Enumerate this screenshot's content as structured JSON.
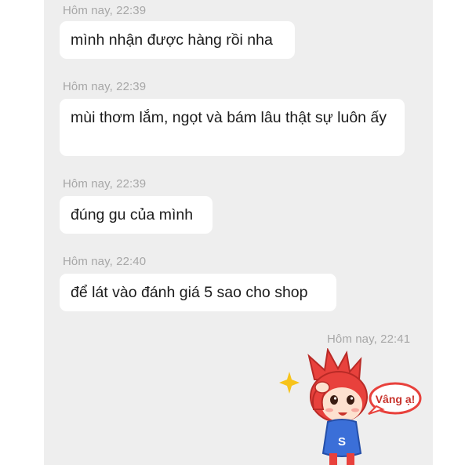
{
  "chat": {
    "messages": [
      {
        "time": "Hôm nay, 22:39",
        "text": "mình nhận được hàng rồi nha"
      },
      {
        "time": "Hôm nay, 22:39",
        "text": "mùi thơm lắm, ngọt và bám lâu thật sự luôn ấy"
      },
      {
        "time": "Hôm nay, 22:39",
        "text": "đúng gu của mình"
      },
      {
        "time": "Hôm nay, 22:40",
        "text": "để lát vào đánh giá 5 sao cho shop"
      }
    ],
    "reply": {
      "time": "Hôm nay, 22:41",
      "sticker_text": "Vâng ạ!",
      "sticker_shirt_letter": "S"
    }
  },
  "colors": {
    "panel_bg": "#eeeeee",
    "bubble_bg": "#ffffff",
    "timestamp": "#a7a7a7",
    "sticker_red": "#e8413c",
    "sticker_blue": "#3b6fd8",
    "sparkle": "#f7c31a"
  }
}
